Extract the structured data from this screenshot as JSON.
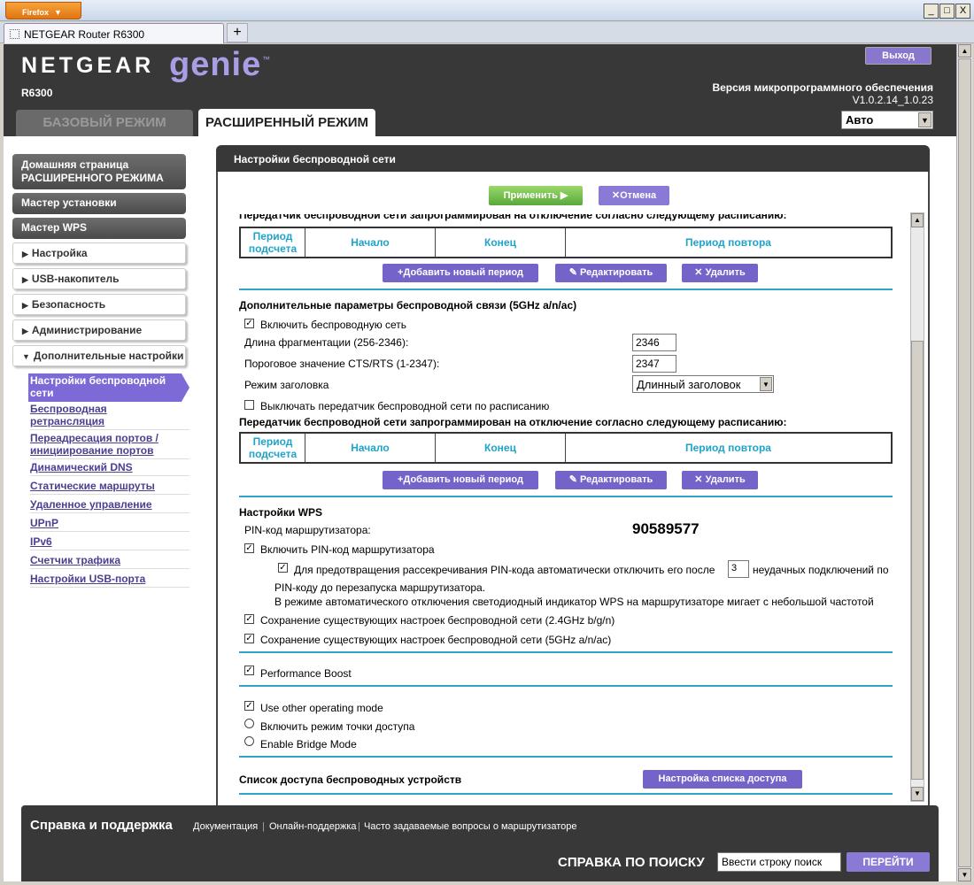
{
  "browser": {
    "menu_label": "Firefox",
    "tab_title": "NETGEAR Router R6300",
    "new_tab": "+",
    "min": "_",
    "max": "□",
    "close": "X"
  },
  "header": {
    "brand": "NETGEAR",
    "product": "genie",
    "tm": "™",
    "model": "R6300",
    "logout": "Выход",
    "fw_label": "Версия микропрограммного обеспечения",
    "fw_version": "V1.0.2.14_1.0.23",
    "language": "Авто",
    "tab_basic": "БАЗОВЫЙ РЕЖИМ",
    "tab_advanced": "РАСШИРЕННЫЙ РЕЖИМ"
  },
  "sidebar": {
    "home_l1": "Домашняя страница",
    "home_l2": "РАСШИРЕННОГО РЕЖИМА",
    "wizard": "Мастер установки",
    "wps_wizard": "Мастер WPS",
    "setup": "Настройка",
    "usb": "USB-накопитель",
    "security": "Безопасность",
    "admin": "Администрирование",
    "advanced": "Дополнительные настройки",
    "active_l1": "Настройки беспроводной",
    "active_l2": "сети",
    "sub": [
      [
        "Беспроводная",
        "ретрансляция"
      ],
      [
        "Переадресация портов /",
        "инициирование портов"
      ],
      [
        "Динамический DNS"
      ],
      [
        "Статические маршруты"
      ],
      [
        "Удаленное управление"
      ],
      [
        "UPnP"
      ],
      [
        "IPv6"
      ],
      [
        "Счетчик трафика"
      ],
      [
        "Настройки USB-порта"
      ]
    ]
  },
  "content": {
    "title": "Настройки беспроводной сети",
    "apply": "Применить ▶",
    "cancel": "Отмена",
    "sched_note": "Передатчик беспроводной сети запрограммирован на отключение согласно следующему расписанию:",
    "sched_cols": [
      "Период подсчета",
      "Начало",
      "Конец",
      "Период повтора"
    ],
    "add_period": "Добавить новый период",
    "edit": "Редактировать",
    "delete": "Удалить",
    "adv5_title": "Дополнительные параметры беспроводной связи (5GHz a/n/ac)",
    "enable_wireless": "Включить беспроводную сеть",
    "frag_label": "Длина фрагментации (256-2346):",
    "frag_value": "2346",
    "cts_label": "Пороговое значение CTS/RTS (1-2347):",
    "cts_value": "2347",
    "preamble_label": "Режим заголовка",
    "preamble_value": "Длинный заголовок",
    "schedule_off": "Выключать передатчик беспроводной сети по расписанию",
    "wps_title": "Настройки WPS",
    "pin_label": "PIN-код маршрутизатора:",
    "pin_value": "90589577",
    "enable_pin": "Включить PIN-код маршрутизатора",
    "pin_protect_a": "Для предотвращения рассекречивания PIN-кода автоматически отключить его после",
    "pin_attempts": "3",
    "pin_protect_b": "неудачных подключений по",
    "pin_protect_c": "PIN-коду до перезапуска маршрутизатора.",
    "pin_protect_d": "В режиме автоматического отключения светодиодный индикатор WPS на маршрутизаторе мигает с небольшой частотой",
    "keep24": "Сохранение существующих настроек беспроводной сети (2.4GHz b/g/n)",
    "keep5": "Сохранение существующих настроек беспроводной сети (5GHz a/n/ac)",
    "perf_boost": "Performance Boost",
    "other_mode": "Use other operating mode",
    "ap_mode": "Включить режим точки доступа",
    "bridge_mode": "Enable Bridge Mode",
    "acl_title": "Список доступа беспроводных устройств",
    "acl_button": "Настройка списка доступа",
    "check": "✓"
  },
  "footer": {
    "title": "Справка и поддержка",
    "links": [
      "Документация",
      "Онлайн-поддержка",
      "Часто задаваемые вопросы о маршрутизаторе"
    ],
    "search_label": "СПРАВКА ПО ПОИСКУ",
    "search_value": "Ввести строку поиск",
    "go": "ПЕРЕЙТИ"
  }
}
